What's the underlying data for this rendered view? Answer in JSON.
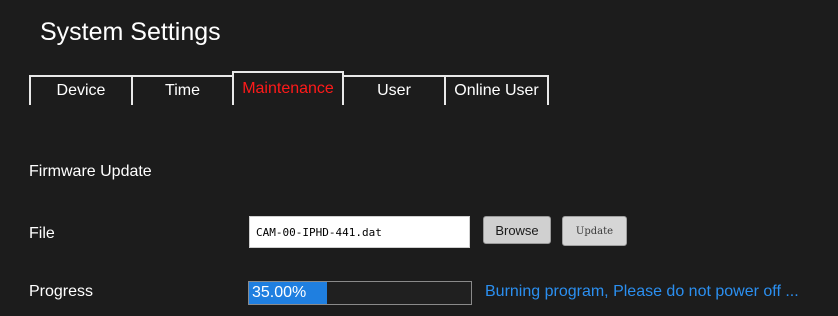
{
  "header": {
    "title": "System Settings"
  },
  "tabs": [
    {
      "label": "Device",
      "active": false
    },
    {
      "label": "Time",
      "active": false
    },
    {
      "label": "Maintenance",
      "active": true
    },
    {
      "label": "User",
      "active": false
    },
    {
      "label": "Online User",
      "active": false
    }
  ],
  "firmware": {
    "section_title": "Firmware Update",
    "file_label": "File",
    "file_value": "CAM-00-IPHD-441.dat",
    "browse_label": "Browse",
    "update_label": "Update",
    "progress_label": "Progress",
    "progress_text": "35.00%",
    "progress_value": 0.35,
    "status_text": "Burning program, Please do not power off ..."
  },
  "colors": {
    "background": "#1c1c1c",
    "active_tab_text": "#ff1a1a",
    "progress_fill": "#1f7fe0",
    "status_text": "#2b8ff0"
  }
}
